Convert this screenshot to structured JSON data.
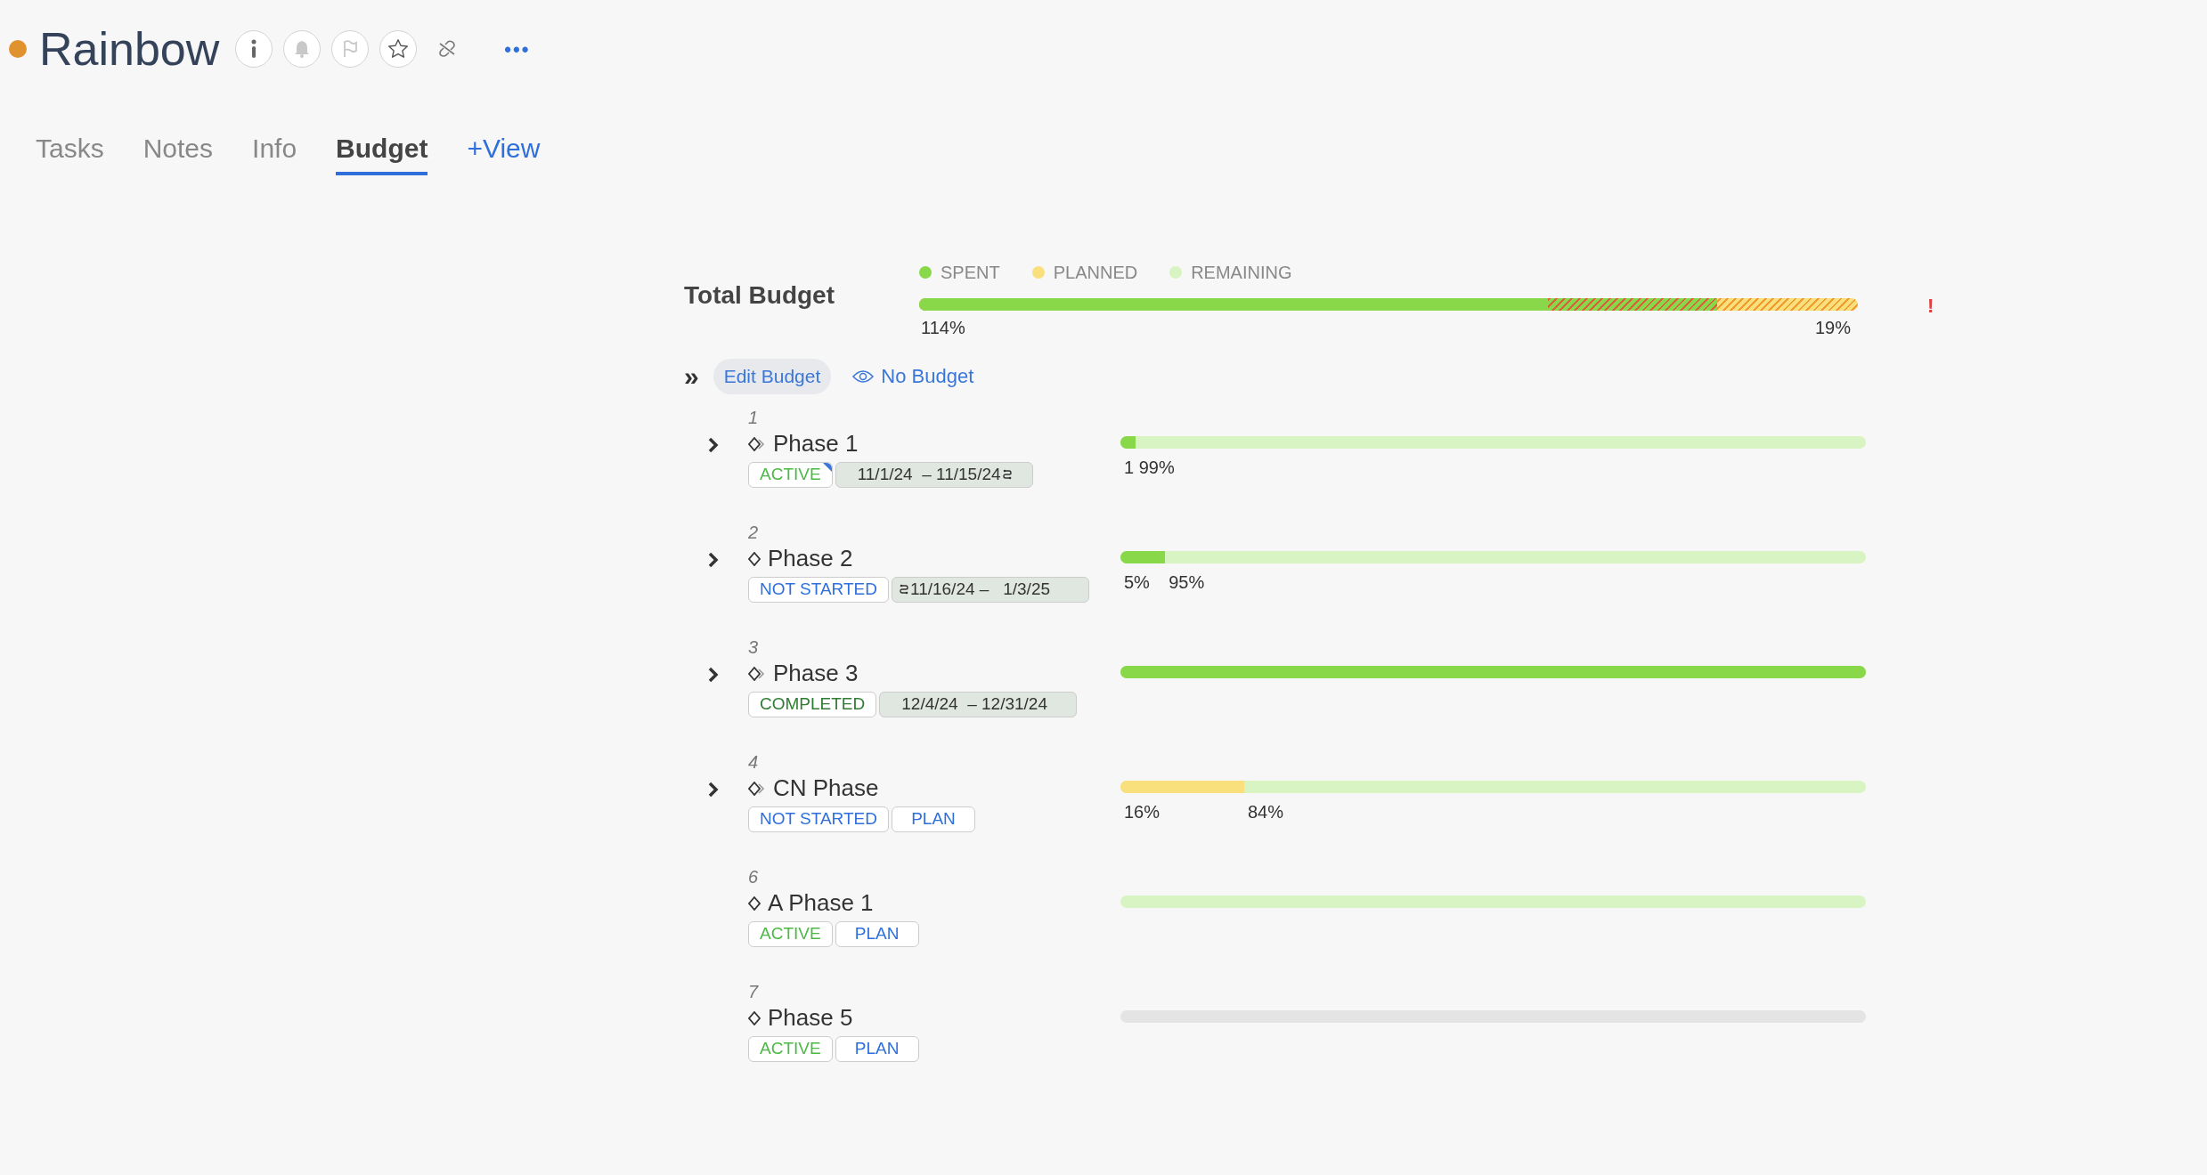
{
  "header": {
    "title": "Rainbow",
    "more": "•••"
  },
  "tabs": [
    {
      "label": "Tasks",
      "selected": false,
      "kind": "tab"
    },
    {
      "label": "Notes",
      "selected": false,
      "kind": "tab"
    },
    {
      "label": "Info",
      "selected": false,
      "kind": "tab"
    },
    {
      "label": "Budget",
      "selected": true,
      "kind": "tab"
    },
    {
      "label": "+View",
      "selected": false,
      "kind": "add"
    }
  ],
  "total_budget": {
    "label": "Total Budget",
    "legend": [
      {
        "label": "SPENT",
        "color": "#88d84a"
      },
      {
        "label": "PLANNED",
        "color": "#fadf7d"
      },
      {
        "label": "REMAINING",
        "color": "#d8f4c3"
      }
    ],
    "track": {
      "kind": "overplanned"
    },
    "fills": [
      {
        "kind": "overspent",
        "level": 0.85
      },
      {
        "kind": "spent",
        "level": 0.67
      }
    ],
    "left_label": "114%",
    "right_label": "19%",
    "warning": "!"
  },
  "actions": {
    "collapse": "»",
    "edit_button": "Edit Budget",
    "no_budget": "No Budget"
  },
  "phases": [
    {
      "number": "1",
      "name": "Phase 1",
      "expandable": true,
      "linked": true,
      "status": {
        "text": "ACTIVE",
        "kind": "active"
      },
      "status_flag": true,
      "tag": {
        "kind": "dates",
        "text": "11/1/24  – 11/15/24",
        "sync_before": false,
        "sync_after": true
      },
      "track": {
        "kind": "remaining"
      },
      "fill": {
        "kind": "spent",
        "level": 0.02,
        "label": "1"
      },
      "remaining_label": "99%"
    },
    {
      "number": "2",
      "name": "Phase 2",
      "expandable": true,
      "linked": false,
      "status": {
        "text": "NOT STARTED",
        "kind": "not_started"
      },
      "status_flag": false,
      "tag": {
        "kind": "dates",
        "text": "11/16/24 –   1/3/25",
        "sync_before": true,
        "sync_after": false
      },
      "track": {
        "kind": "remaining"
      },
      "fill": {
        "kind": "spent",
        "level": 0.06,
        "label": "5%"
      },
      "remaining_label": "95%"
    },
    {
      "number": "3",
      "name": "Phase 3",
      "expandable": true,
      "linked": true,
      "status": {
        "text": "COMPLETED",
        "kind": "completed"
      },
      "status_flag": false,
      "tag": {
        "kind": "dates",
        "text": "12/4/24  – 12/31/24",
        "sync_before": false,
        "sync_after": false
      },
      "track": {
        "kind": "remaining"
      },
      "fill": {
        "kind": "spent",
        "level": 1
      }
    },
    {
      "number": "4",
      "name": "CN Phase",
      "expandable": true,
      "linked": true,
      "status": {
        "text": "NOT STARTED",
        "kind": "not_started"
      },
      "status_flag": false,
      "tag": {
        "kind": "plan",
        "text": "PLAN"
      },
      "track": {
        "kind": "remaining"
      },
      "fill": {
        "kind": "planned",
        "level": 0.166,
        "label": "16%"
      },
      "remaining_label": "84%"
    },
    {
      "number": "6",
      "name": "A Phase 1",
      "expandable": false,
      "linked": false,
      "status": {
        "text": "ACTIVE",
        "kind": "active"
      },
      "status_flag": false,
      "tag": {
        "kind": "plan",
        "text": "PLAN"
      },
      "track": {
        "kind": "remaining"
      }
    },
    {
      "number": "7",
      "name": "Phase 5",
      "expandable": false,
      "linked": false,
      "status": {
        "text": "ACTIVE",
        "kind": "active"
      },
      "status_flag": false,
      "tag": {
        "kind": "plan",
        "text": "PLAN"
      },
      "track": {
        "kind": "empty"
      }
    }
  ]
}
